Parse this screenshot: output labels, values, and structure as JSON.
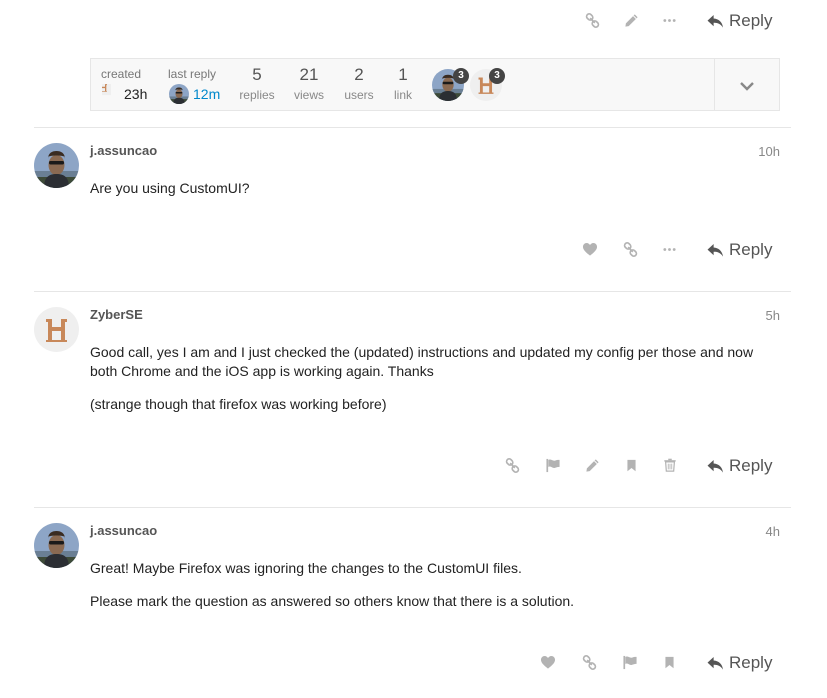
{
  "top_actions": {
    "reply_label": "Reply"
  },
  "topic_map": {
    "created_label": "created",
    "created_time": "23h",
    "last_reply_label": "last reply",
    "last_reply_time": "12m",
    "stats": [
      {
        "value": "5",
        "label": "replies"
      },
      {
        "value": "21",
        "label": "views"
      },
      {
        "value": "2",
        "label": "users"
      },
      {
        "value": "1",
        "label": "link"
      }
    ],
    "participants": [
      {
        "badge": "3"
      },
      {
        "badge": "3"
      }
    ]
  },
  "posts": [
    {
      "username": "j.assuncao",
      "time": "10h",
      "paragraphs": [
        "Are you using CustomUI?"
      ],
      "reply_label": "Reply"
    },
    {
      "username": "ZyberSE",
      "time": "5h",
      "paragraphs": [
        "Good call, yes I am and I just checked the (updated) instructions and updated my config per those and now both Chrome and the iOS app is working again. Thanks",
        "(strange though that firefox was working before)"
      ],
      "reply_label": "Reply"
    },
    {
      "username": "j.assuncao",
      "time": "4h",
      "paragraphs": [
        "Great! Maybe Firefox was ignoring the changes to the CustomUI files.",
        "Please mark the question as answered so others know that there is a solution."
      ],
      "reply_label": "Reply"
    }
  ],
  "colors": {
    "link_blue": "#0088cc",
    "icon_gray": "#b3b3b3",
    "avatar_letter_bg": "#efefef",
    "avatar_letter_fg": "#c8885a"
  }
}
